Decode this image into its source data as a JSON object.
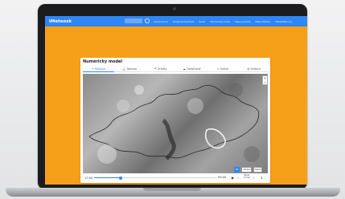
{
  "site": {
    "logo": "iMeteosk",
    "nav_links": [
      "Sprievodca ▾",
      "Predpoveď počasia",
      "Radar",
      "Numerický model",
      "Mapa počasia",
      "Mapa bleskov",
      "MeteoWarning"
    ]
  },
  "panel": {
    "title": "Numerický model",
    "tabs": [
      {
        "label": "Počasie",
        "icon": "☀"
      },
      {
        "label": "Teplota",
        "icon": "🌡"
      },
      {
        "label": "Zrážky",
        "icon": "☂"
      },
      {
        "label": "Oblačnosť",
        "icon": "☁"
      },
      {
        "label": "Vietor",
        "icon": "≈"
      },
      {
        "label": "Vzduch",
        "icon": "⚙"
      }
    ],
    "active_tab": 0
  },
  "legend": [
    "SK",
    "Oblast",
    "Detail"
  ],
  "timeline": {
    "start": "17:00",
    "end": "00:00",
    "progress": 0.22,
    "now_label": "Teraz",
    "now_time": "17:00"
  },
  "colors": {
    "screen_bg": "#f6a01a",
    "nav_bg": "#2f86f6",
    "accent": "#2f86f6"
  }
}
